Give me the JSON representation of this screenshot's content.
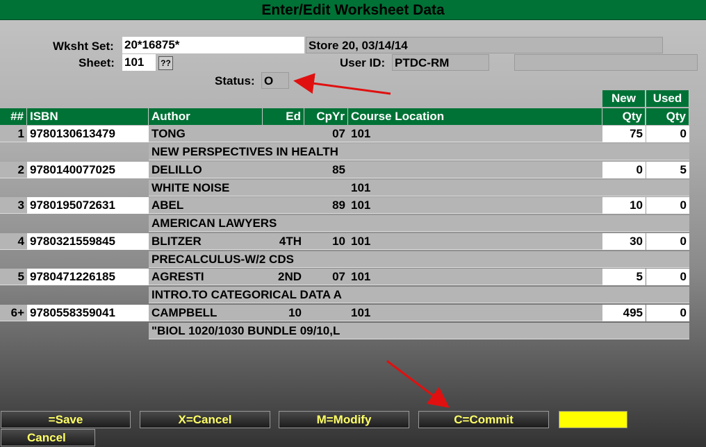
{
  "window": {
    "title": "Enter/Edit Worksheet Data"
  },
  "header": {
    "wksht_set_label": "Wksht Set:",
    "wksht_set_value": "20*16875*",
    "store_info": "Store 20,  03/14/14",
    "sheet_label": "Sheet:",
    "sheet_value": "101",
    "lookup_label": "??",
    "user_id_label": "User ID:",
    "user_id_value": "PTDC-RM",
    "status_label": "Status:",
    "status_value": "O"
  },
  "table": {
    "group_headers": {
      "new": "New",
      "used": "Used"
    },
    "columns": {
      "num": "##",
      "isbn": "ISBN",
      "author": "Author",
      "ed": "Ed",
      "cpyr": "CpYr",
      "course": "Course Location",
      "qty_new": "Qty",
      "qty_used": "Qty"
    },
    "rows": [
      {
        "num": "1",
        "isbn": "9780130613479",
        "author": "TONG",
        "ed": "",
        "cpyr": "07",
        "course": "101",
        "qty_new": "75",
        "qty_used": "0",
        "title": "NEW PERSPECTIVES IN HEALTH",
        "title_course": ""
      },
      {
        "num": "2",
        "isbn": "9780140077025",
        "author": "DELILLO",
        "ed": "",
        "cpyr": "85",
        "course": "",
        "qty_new": "0",
        "qty_used": "5",
        "title": "WHITE NOISE",
        "title_course": "101"
      },
      {
        "num": "3",
        "isbn": "9780195072631",
        "author": "ABEL",
        "ed": "",
        "cpyr": "89",
        "course": "101",
        "qty_new": "10",
        "qty_used": "0",
        "title": "AMERICAN LAWYERS",
        "title_course": ""
      },
      {
        "num": "4",
        "isbn": "9780321559845",
        "author": "BLITZER",
        "ed": "4TH",
        "cpyr": "10",
        "course": "101",
        "qty_new": "30",
        "qty_used": "0",
        "title": "PRECALCULUS-W/2 CDS",
        "title_course": ""
      },
      {
        "num": "5",
        "isbn": "9780471226185",
        "author": "AGRESTI",
        "ed": "2ND",
        "cpyr": "07",
        "course": "101",
        "qty_new": "5",
        "qty_used": "0",
        "title": "INTRO.TO CATEGORICAL DATA A",
        "title_course": ""
      },
      {
        "num": "6+",
        "isbn": "9780558359041",
        "author": "CAMPBELL",
        "ed": "10",
        "cpyr": "",
        "course": "101",
        "qty_new": "495",
        "qty_used": "0",
        "title": "\"BIOL 1020/1030 BUNDLE 09/10,L",
        "title_course": ""
      }
    ]
  },
  "footer": {
    "save": "=Save",
    "cancel_x": "X=Cancel",
    "modify": "M=Modify",
    "commit": "C=Commit",
    "cancel": "Cancel"
  },
  "colors": {
    "title_green": "#007236",
    "highlight_yellow": "#ffff00",
    "button_text": "#ffff66",
    "arrow": "#e01010"
  }
}
